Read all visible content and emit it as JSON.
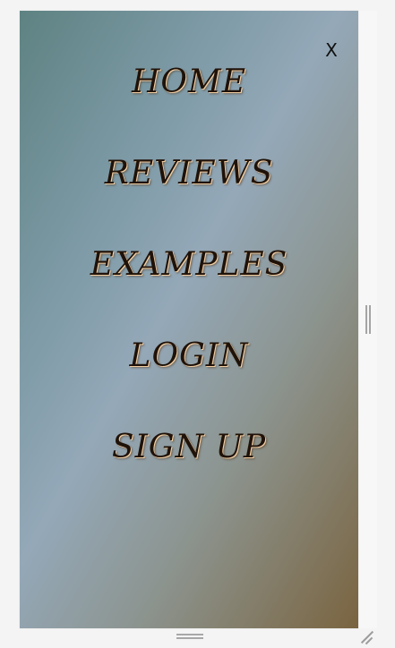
{
  "menu": {
    "close_label": "X",
    "items": [
      {
        "label": "HOME"
      },
      {
        "label": "REVIEWS"
      },
      {
        "label": "EXAMPLES"
      },
      {
        "label": "LOGIN"
      },
      {
        "label": "SIGN UP"
      }
    ]
  },
  "icons": {
    "side_handle": "vertical-resize-handle-icon",
    "bottom_handle": "horizontal-resize-handle-icon",
    "corner_grip": "resize-grip-icon"
  },
  "colors": {
    "panel_start": "#5e8282",
    "panel_mid": "#94a8b8",
    "panel_end": "#7a6440",
    "menu_text": "#1f1209",
    "menu_glow": "#f3cfa3"
  }
}
